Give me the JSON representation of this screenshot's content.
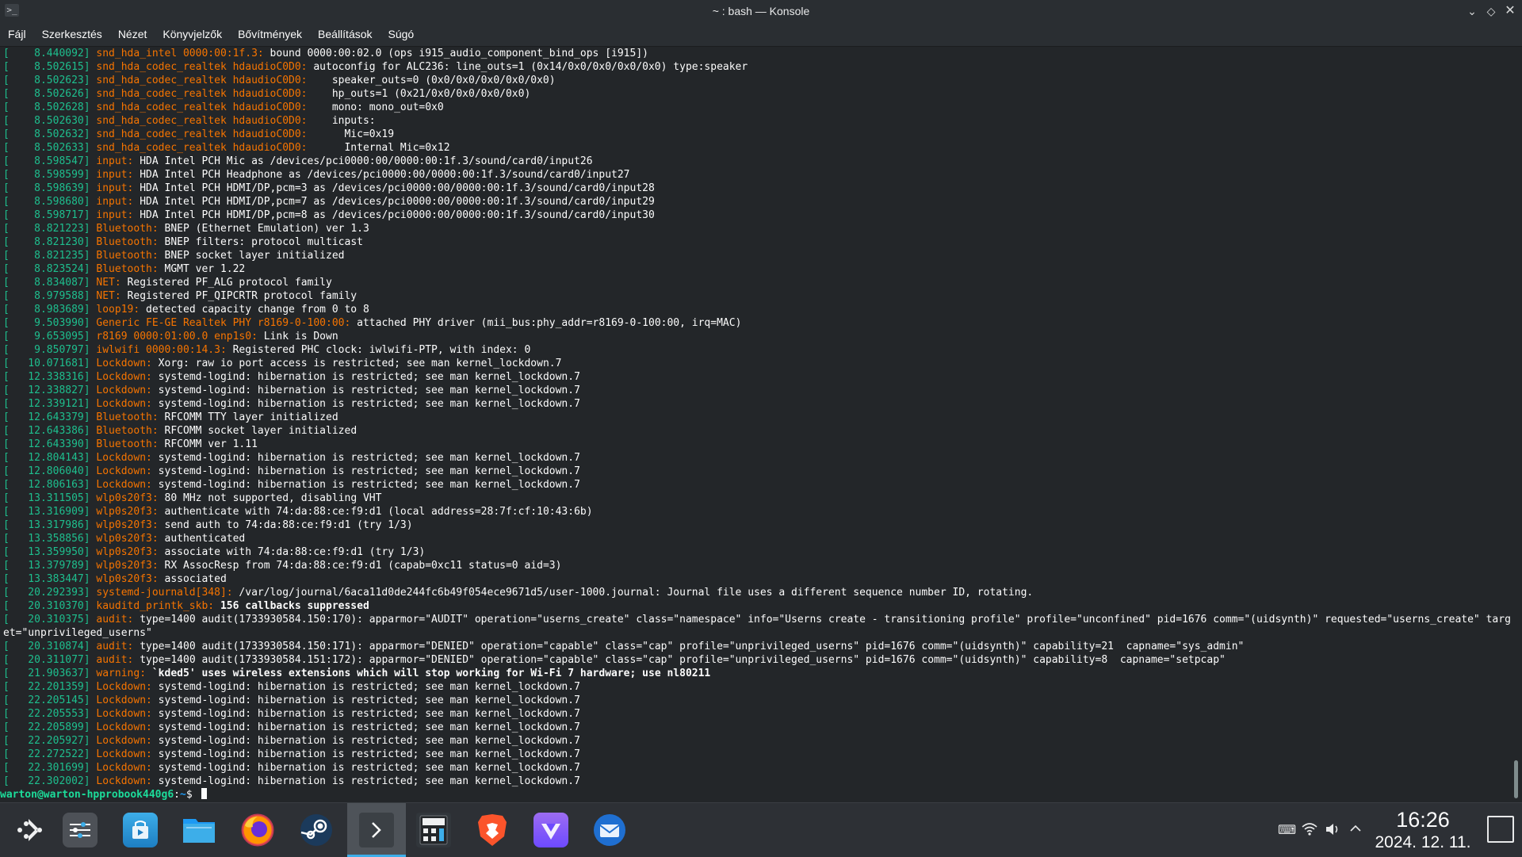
{
  "window": {
    "title": "~ : bash — Konsole",
    "app_icon": ">_",
    "controls": {
      "minimize": "⌄",
      "maximize": "◇",
      "close": "✕"
    }
  },
  "menu": [
    "Fájl",
    "Szerkesztés",
    "Nézet",
    "Könyvjelzők",
    "Bővítmények",
    "Beállítások",
    "Súgó"
  ],
  "colors": {
    "timestamp": "#1ebf8e",
    "facility": "#f67400",
    "text": "#fcfcfc",
    "prompt_user": "#1cdc9a",
    "prompt_path": "#1d99f3",
    "active_task": "#3daee9"
  },
  "terminal": {
    "lines": [
      {
        "ts": "    8.440092",
        "fac": "snd_hda_intel 0000:00:1f.3:",
        "msg": " bound 0000:00:02.0 (ops i915_audio_component_bind_ops [i915])"
      },
      {
        "ts": "    8.502615",
        "fac": "snd_hda_codec_realtek hdaudioC0D0:",
        "msg": " autoconfig for ALC236: line_outs=1 (0x14/0x0/0x0/0x0/0x0) type:speaker"
      },
      {
        "ts": "    8.502623",
        "fac": "snd_hda_codec_realtek hdaudioC0D0:",
        "msg": "    speaker_outs=0 (0x0/0x0/0x0/0x0/0x0)"
      },
      {
        "ts": "    8.502626",
        "fac": "snd_hda_codec_realtek hdaudioC0D0:",
        "msg": "    hp_outs=1 (0x21/0x0/0x0/0x0/0x0)"
      },
      {
        "ts": "    8.502628",
        "fac": "snd_hda_codec_realtek hdaudioC0D0:",
        "msg": "    mono: mono_out=0x0"
      },
      {
        "ts": "    8.502630",
        "fac": "snd_hda_codec_realtek hdaudioC0D0:",
        "msg": "    inputs:"
      },
      {
        "ts": "    8.502632",
        "fac": "snd_hda_codec_realtek hdaudioC0D0:",
        "msg": "      Mic=0x19"
      },
      {
        "ts": "    8.502633",
        "fac": "snd_hda_codec_realtek hdaudioC0D0:",
        "msg": "      Internal Mic=0x12"
      },
      {
        "ts": "    8.598547",
        "fac": "input:",
        "msg": " HDA Intel PCH Mic as /devices/pci0000:00/0000:00:1f.3/sound/card0/input26"
      },
      {
        "ts": "    8.598599",
        "fac": "input:",
        "msg": " HDA Intel PCH Headphone as /devices/pci0000:00/0000:00:1f.3/sound/card0/input27"
      },
      {
        "ts": "    8.598639",
        "fac": "input:",
        "msg": " HDA Intel PCH HDMI/DP,pcm=3 as /devices/pci0000:00/0000:00:1f.3/sound/card0/input28"
      },
      {
        "ts": "    8.598680",
        "fac": "input:",
        "msg": " HDA Intel PCH HDMI/DP,pcm=7 as /devices/pci0000:00/0000:00:1f.3/sound/card0/input29"
      },
      {
        "ts": "    8.598717",
        "fac": "input:",
        "msg": " HDA Intel PCH HDMI/DP,pcm=8 as /devices/pci0000:00/0000:00:1f.3/sound/card0/input30"
      },
      {
        "ts": "    8.821223",
        "fac": "Bluetooth:",
        "msg": " BNEP (Ethernet Emulation) ver 1.3"
      },
      {
        "ts": "    8.821230",
        "fac": "Bluetooth:",
        "msg": " BNEP filters: protocol multicast"
      },
      {
        "ts": "    8.821235",
        "fac": "Bluetooth:",
        "msg": " BNEP socket layer initialized"
      },
      {
        "ts": "    8.823524",
        "fac": "Bluetooth:",
        "msg": " MGMT ver 1.22"
      },
      {
        "ts": "    8.834087",
        "fac": "NET:",
        "msg": " Registered PF_ALG protocol family"
      },
      {
        "ts": "    8.979588",
        "fac": "NET:",
        "msg": " Registered PF_QIPCRTR protocol family"
      },
      {
        "ts": "    8.983689",
        "fac": "loop19:",
        "msg": " detected capacity change from 0 to 8"
      },
      {
        "ts": "    9.503990",
        "fac": "Generic FE-GE Realtek PHY r8169-0-100:00:",
        "msg": " attached PHY driver (mii_bus:phy_addr=r8169-0-100:00, irq=MAC)"
      },
      {
        "ts": "    9.653095",
        "fac": "r8169 0000:01:00.0 enp1s0:",
        "msg": " Link is Down"
      },
      {
        "ts": "    9.850797",
        "fac": "iwlwifi 0000:00:14.3:",
        "msg": " Registered PHC clock: iwlwifi-PTP, with index: 0"
      },
      {
        "ts": "   10.071681",
        "fac": "Lockdown:",
        "msg": " Xorg: raw io port access is restricted; see man kernel_lockdown.7"
      },
      {
        "ts": "   12.338316",
        "fac": "Lockdown:",
        "msg": " systemd-logind: hibernation is restricted; see man kernel_lockdown.7"
      },
      {
        "ts": "   12.338827",
        "fac": "Lockdown:",
        "msg": " systemd-logind: hibernation is restricted; see man kernel_lockdown.7"
      },
      {
        "ts": "   12.339121",
        "fac": "Lockdown:",
        "msg": " systemd-logind: hibernation is restricted; see man kernel_lockdown.7"
      },
      {
        "ts": "   12.643379",
        "fac": "Bluetooth:",
        "msg": " RFCOMM TTY layer initialized"
      },
      {
        "ts": "   12.643386",
        "fac": "Bluetooth:",
        "msg": " RFCOMM socket layer initialized"
      },
      {
        "ts": "   12.643390",
        "fac": "Bluetooth:",
        "msg": " RFCOMM ver 1.11"
      },
      {
        "ts": "   12.804143",
        "fac": "Lockdown:",
        "msg": " systemd-logind: hibernation is restricted; see man kernel_lockdown.7"
      },
      {
        "ts": "   12.806040",
        "fac": "Lockdown:",
        "msg": " systemd-logind: hibernation is restricted; see man kernel_lockdown.7"
      },
      {
        "ts": "   12.806163",
        "fac": "Lockdown:",
        "msg": " systemd-logind: hibernation is restricted; see man kernel_lockdown.7"
      },
      {
        "ts": "   13.311505",
        "fac": "wlp0s20f3:",
        "msg": " 80 MHz not supported, disabling VHT"
      },
      {
        "ts": "   13.316909",
        "fac": "wlp0s20f3:",
        "msg": " authenticate with 74:da:88:ce:f9:d1 (local address=28:7f:cf:10:43:6b)"
      },
      {
        "ts": "   13.317986",
        "fac": "wlp0s20f3:",
        "msg": " send auth to 74:da:88:ce:f9:d1 (try 1/3)"
      },
      {
        "ts": "   13.358856",
        "fac": "wlp0s20f3:",
        "msg": " authenticated"
      },
      {
        "ts": "   13.359950",
        "fac": "wlp0s20f3:",
        "msg": " associate with 74:da:88:ce:f9:d1 (try 1/3)"
      },
      {
        "ts": "   13.379789",
        "fac": "wlp0s20f3:",
        "msg": " RX AssocResp from 74:da:88:ce:f9:d1 (capab=0xc11 status=0 aid=3)"
      },
      {
        "ts": "   13.383447",
        "fac": "wlp0s20f3:",
        "msg": " associated"
      },
      {
        "ts": "   20.292393",
        "fac": "systemd-journald[348]:",
        "msg": " /var/log/journal/6aca11d0de244fc6b49f054ece9671d5/user-1000.journal: Journal file uses a different sequence number ID, rotating."
      },
      {
        "ts": "   20.310370",
        "fac": "kauditd_printk_skb:",
        "msg": " 156 callbacks suppressed",
        "bold": true
      },
      {
        "ts": "   20.310375",
        "fac": "audit:",
        "msg": " type=1400 audit(1733930584.150:170): apparmor=\"AUDIT\" operation=\"userns_create\" class=\"namespace\" info=\"Userns create - transitioning profile\" profile=\"unconfined\" pid=1676 comm=\"(uidsynth)\" requested=\"userns_create\" target=\"unprivileged_userns\"",
        "wrap": true
      },
      {
        "ts": "   20.310874",
        "fac": "audit:",
        "msg": " type=1400 audit(1733930584.150:171): apparmor=\"DENIED\" operation=\"capable\" class=\"cap\" profile=\"unprivileged_userns\" pid=1676 comm=\"(uidsynth)\" capability=21  capname=\"sys_admin\""
      },
      {
        "ts": "   20.311077",
        "fac": "audit:",
        "msg": " type=1400 audit(1733930584.151:172): apparmor=\"DENIED\" operation=\"capable\" class=\"cap\" profile=\"unprivileged_userns\" pid=1676 comm=\"(uidsynth)\" capability=8  capname=\"setpcap\""
      },
      {
        "ts": "   21.903637",
        "fac": "warning:",
        "msg": " `kded5' uses wireless extensions which will stop working for Wi-Fi 7 hardware; use nl80211",
        "bold": true
      },
      {
        "ts": "   22.201359",
        "fac": "Lockdown:",
        "msg": " systemd-logind: hibernation is restricted; see man kernel_lockdown.7"
      },
      {
        "ts": "   22.205145",
        "fac": "Lockdown:",
        "msg": " systemd-logind: hibernation is restricted; see man kernel_lockdown.7"
      },
      {
        "ts": "   22.205553",
        "fac": "Lockdown:",
        "msg": " systemd-logind: hibernation is restricted; see man kernel_lockdown.7"
      },
      {
        "ts": "   22.205899",
        "fac": "Lockdown:",
        "msg": " systemd-logind: hibernation is restricted; see man kernel_lockdown.7"
      },
      {
        "ts": "   22.205927",
        "fac": "Lockdown:",
        "msg": " systemd-logind: hibernation is restricted; see man kernel_lockdown.7"
      },
      {
        "ts": "   22.272522",
        "fac": "Lockdown:",
        "msg": " systemd-logind: hibernation is restricted; see man kernel_lockdown.7"
      },
      {
        "ts": "   22.301699",
        "fac": "Lockdown:",
        "msg": " systemd-logind: hibernation is restricted; see man kernel_lockdown.7"
      },
      {
        "ts": "   22.302002",
        "fac": "Lockdown:",
        "msg": " systemd-logind: hibernation is restricted; see man kernel_lockdown.7"
      }
    ],
    "prompt": {
      "user": "warton@warton-hpprobook440g6",
      "sep": ":",
      "path": "~",
      "dollar": "$ "
    }
  },
  "taskbar": {
    "tasks": [
      {
        "name": "application-launcher-icon"
      },
      {
        "name": "system-settings-icon"
      },
      {
        "name": "discover-store-icon"
      },
      {
        "name": "dolphin-file-manager-icon"
      },
      {
        "name": "firefox-icon"
      },
      {
        "name": "steam-icon"
      },
      {
        "name": "konsole-icon",
        "active": true
      },
      {
        "name": "calculator-icon"
      },
      {
        "name": "brave-browser-icon"
      },
      {
        "name": "protonvpn-icon"
      },
      {
        "name": "thunderbird-icon"
      }
    ],
    "clock": {
      "time": "16:26",
      "date": "2024. 12. 11."
    }
  }
}
